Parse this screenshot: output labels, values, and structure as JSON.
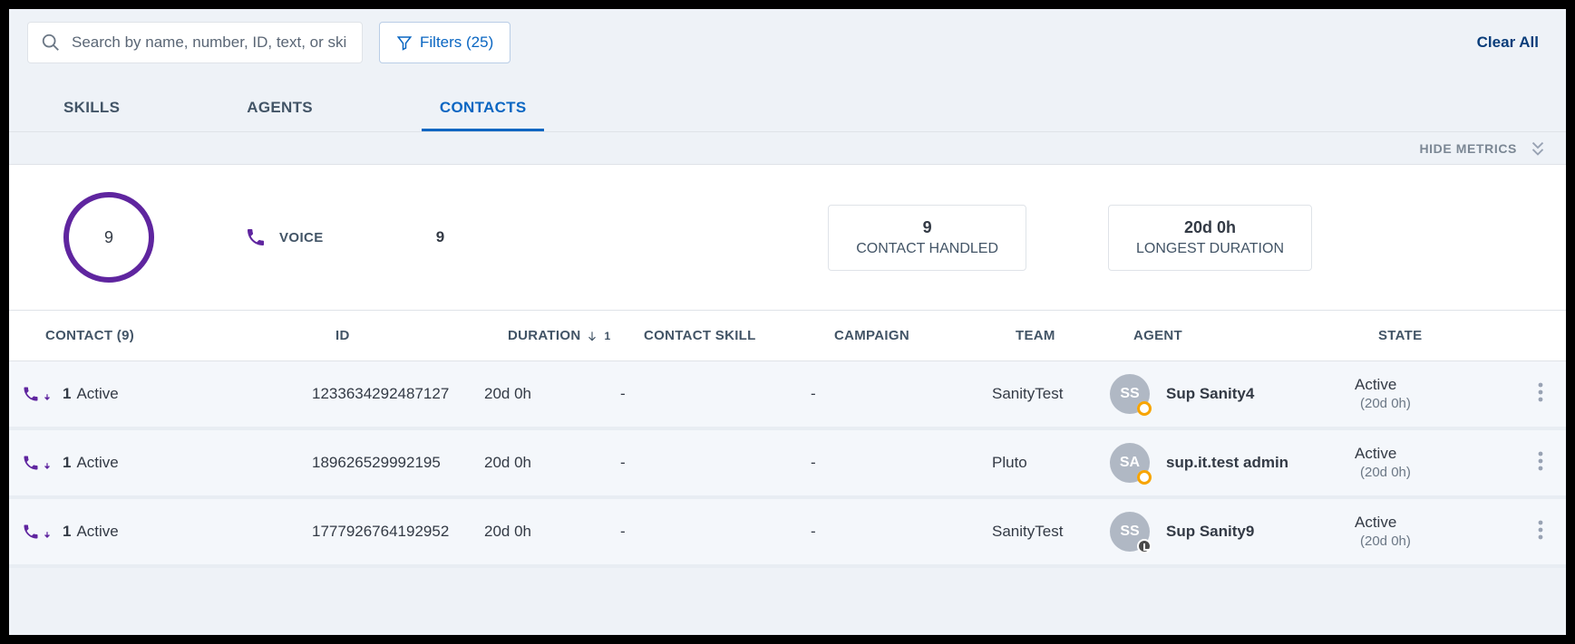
{
  "search": {
    "placeholder": "Search by name, number, ID, text, or skill"
  },
  "filters_button": "Filters (25)",
  "clear_all": "Clear All",
  "tabs": {
    "skills": "SKILLS",
    "agents": "AGENTS",
    "contacts": "CONTACTS"
  },
  "hide_metrics": "HIDE METRICS",
  "metrics": {
    "ring_value": "9",
    "voice_label": "VOICE",
    "voice_count": "9",
    "cards": [
      {
        "value": "9",
        "label": "CONTACT HANDLED"
      },
      {
        "value": "20d 0h",
        "label": "LONGEST DURATION"
      }
    ]
  },
  "columns": {
    "contact": "CONTACT (9)",
    "id": "ID",
    "duration": "DURATION",
    "sort_index": "1",
    "skill": "CONTACT SKILL",
    "campaign": "CAMPAIGN",
    "team": "TEAM",
    "agent": "AGENT",
    "state": "STATE"
  },
  "rows": [
    {
      "count": "1",
      "status": "Active",
      "id": "1233634292487127",
      "duration": "20d 0h",
      "skill": "-",
      "campaign": "-",
      "team": "SanityTest",
      "agent_initials": "SS",
      "agent_name": "Sup Sanity4",
      "agent_badge": "orange",
      "state": "Active",
      "state_sub": "(20d 0h)"
    },
    {
      "count": "1",
      "status": "Active",
      "id": "189626529992195",
      "duration": "20d 0h",
      "skill": "-",
      "campaign": "-",
      "team": "Pluto",
      "agent_initials": "SA",
      "agent_name": "sup.it.test admin",
      "agent_badge": "orange",
      "state": "Active",
      "state_sub": "(20d 0h)"
    },
    {
      "count": "1",
      "status": "Active",
      "id": "1777926764192952",
      "duration": "20d 0h",
      "skill": "-",
      "campaign": "-",
      "team": "SanityTest",
      "agent_initials": "SS",
      "agent_name": "Sup Sanity9",
      "agent_badge": "clock",
      "state": "Active",
      "state_sub": "(20d 0h)"
    }
  ]
}
